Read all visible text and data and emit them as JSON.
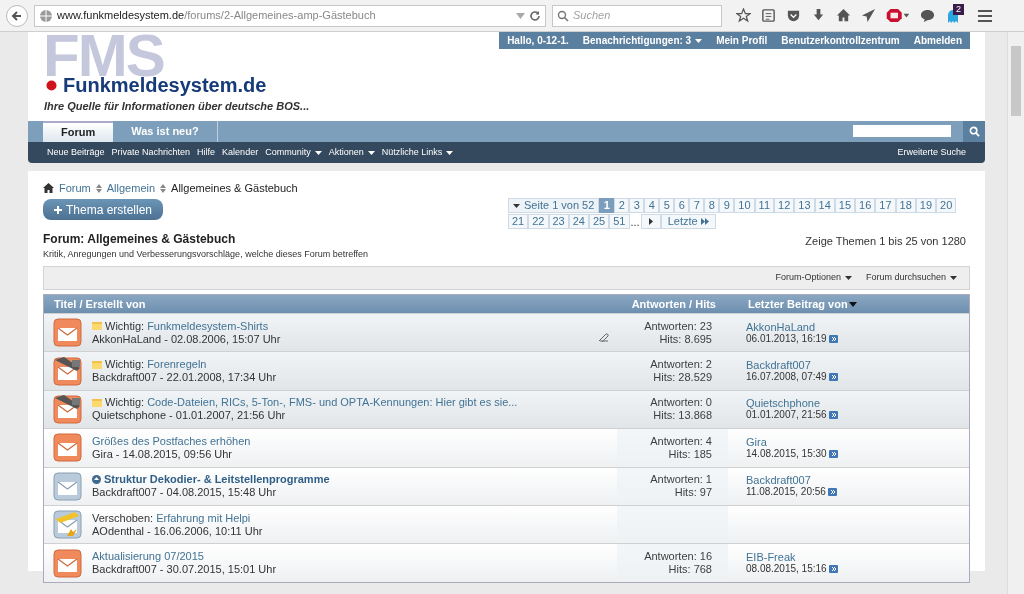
{
  "browser": {
    "url_host": "www.funkmeldesystem.de",
    "url_path": "/forums/2-Allgemeines-amp-Gästebuch",
    "search_placeholder": "Suchen",
    "notification_count": "2"
  },
  "user_nav": [
    {
      "label": "Hallo, 0-12-1.",
      "dropdown": false
    },
    {
      "label": "Benachrichtigungen: 3",
      "dropdown": true
    },
    {
      "label": "Mein Profil",
      "dropdown": false
    },
    {
      "label": "Benutzerkontrollzentrum",
      "dropdown": false
    },
    {
      "label": "Abmelden",
      "dropdown": false
    }
  ],
  "logo": {
    "watermark": "FMS",
    "name": "Funkmeldesystem.de",
    "tagline": "Ihre Quelle für Informationen über deutsche BOS..."
  },
  "tabs": [
    {
      "label": "Forum",
      "selected": true
    },
    {
      "label": "Was ist neu?",
      "selected": false
    }
  ],
  "sub_nav": [
    {
      "label": "Neue Beiträge",
      "dropdown": false
    },
    {
      "label": "Private Nachrichten",
      "dropdown": false
    },
    {
      "label": "Hilfe",
      "dropdown": false
    },
    {
      "label": "Kalender",
      "dropdown": false
    },
    {
      "label": "Community",
      "dropdown": true
    },
    {
      "label": "Aktionen",
      "dropdown": true
    },
    {
      "label": "Nützliche Links",
      "dropdown": true
    }
  ],
  "advanced_search": "Erweiterte Suche",
  "breadcrumb": [
    "Forum",
    "Allgemein",
    "Allgemeines & Gästebuch"
  ],
  "new_thread_button": "Thema erstellen",
  "pagination": {
    "label": "Seite 1 von 52",
    "pages": [
      {
        "label": "1",
        "selected": true
      },
      {
        "label": "2",
        "selected": false
      },
      {
        "label": "3",
        "selected": false
      },
      {
        "label": "4",
        "selected": false
      },
      {
        "label": "5",
        "selected": false
      },
      {
        "label": "6",
        "selected": false
      },
      {
        "label": "7",
        "selected": false
      },
      {
        "label": "8",
        "selected": false
      },
      {
        "label": "9",
        "selected": false
      },
      {
        "label": "10",
        "selected": false
      },
      {
        "label": "11",
        "selected": false
      },
      {
        "label": "12",
        "selected": false
      },
      {
        "label": "13",
        "selected": false
      },
      {
        "label": "14",
        "selected": false
      },
      {
        "label": "15",
        "selected": false
      },
      {
        "label": "16",
        "selected": false
      },
      {
        "label": "17",
        "selected": false
      },
      {
        "label": "18",
        "selected": false
      },
      {
        "label": "19",
        "selected": false
      },
      {
        "label": "20",
        "selected": false
      },
      {
        "label": "21",
        "selected": false
      },
      {
        "label": "22",
        "selected": false
      },
      {
        "label": "23",
        "selected": false
      },
      {
        "label": "24",
        "selected": false
      },
      {
        "label": "25",
        "selected": false
      },
      {
        "label": "51",
        "selected": false
      }
    ],
    "ellipsis": "...",
    "last": "Letzte"
  },
  "thread_count": "Zeige Themen 1 bis 25 von 1280",
  "forum": {
    "title": "Forum: Allgemeines & Gästebuch",
    "description": "Kritik, Anregungen und Verbesserungsvorschläge, welche dieses Forum betreffen"
  },
  "options": [
    "Forum-Optionen",
    "Forum durchsuchen"
  ],
  "columns": [
    "Titel / Erstellt von",
    "Antworten / Hits",
    "Letzter Beitrag von"
  ],
  "threads": [
    {
      "kind": "new",
      "sticky": true,
      "prefix": "Wichtig:",
      "title": "Funkmeldesystem-Shirts",
      "unread": false,
      "author": "AkkonHaLand - 02.08.2006, 15:07 Uhr",
      "attachment": true,
      "replies": "Antworten: 23",
      "hits": "Hits: 8.695",
      "last_user": "AkkonHaLand",
      "last_date": "06.01.2013, 16:19"
    },
    {
      "kind": "locked",
      "sticky": true,
      "prefix": "Wichtig:",
      "title": "Forenregeln",
      "unread": false,
      "author": "Backdraft007 - 22.01.2008, 17:34 Uhr",
      "attachment": false,
      "replies": "Antworten: 2",
      "hits": "Hits: 28.529",
      "last_user": "Backdraft007",
      "last_date": "16.07.2008, 07:49"
    },
    {
      "kind": "locked",
      "sticky": true,
      "prefix": "Wichtig:",
      "title": "Code-Dateien, RICs, 5-Ton-, FMS- und OPTA-Kennungen: Hier gibt es sie...",
      "unread": false,
      "author": "Quietschphone - 01.01.2007, 21:56 Uhr",
      "attachment": false,
      "replies": "Antworten: 0",
      "hits": "Hits: 13.868",
      "last_user": "Quietschphone",
      "last_date": "01.01.2007, 21:56"
    },
    {
      "kind": "new",
      "sticky": false,
      "title": "Größes des Postfaches erhöhen",
      "unread": false,
      "author": "Gira - 14.08.2015, 09:56 Uhr",
      "attachment": false,
      "replies": "Antworten: 4",
      "hits": "Hits: 185",
      "last_user": "Gira",
      "last_date": "14.08.2015, 15:30"
    },
    {
      "kind": "read",
      "sticky": false,
      "title": "Struktur Dekodier- & Leitstellenprogramme",
      "unread": true,
      "author": "Backdraft007 - 04.08.2015, 15:48 Uhr",
      "attachment": false,
      "replies": "Antworten: 1",
      "hits": "Hits: 97",
      "last_user": "Backdraft007",
      "last_date": "11.08.2015, 20:56"
    },
    {
      "kind": "moved",
      "sticky": false,
      "prefix": "Verschoben:",
      "title": "Erfahrung mit Helpi",
      "unread": false,
      "author": "AOdenthal - 16.06.2006, 10:11 Uhr",
      "attachment": false
    },
    {
      "kind": "new",
      "sticky": false,
      "title": "Aktualisierung 07/2015",
      "unread": false,
      "author": "Backdraft007 - 30.07.2015, 15:01 Uhr",
      "attachment": false,
      "replies": "Antworten: 16",
      "hits": "Hits: 768",
      "last_user": "EIB-Freak",
      "last_date": "08.08.2015, 15:16"
    }
  ]
}
